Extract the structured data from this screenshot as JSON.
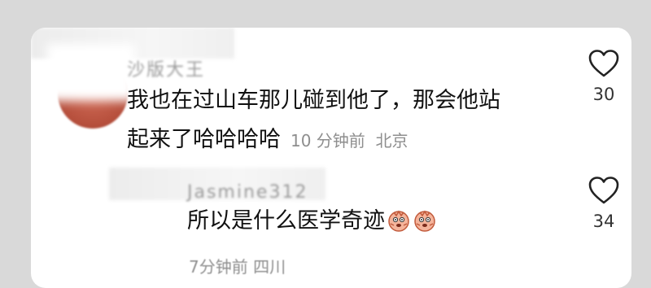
{
  "comment1": {
    "username": "沙版大王",
    "text_line1": "我也在过山车那儿碰到他了，那会他站",
    "text_line2": "起来了哈哈哈哈",
    "time": "10 分钟前",
    "location": "北京",
    "likes": "30"
  },
  "reply1": {
    "username": "Jasmine312",
    "text": "所以是什么医学奇迹",
    "emoji_icon": "scared-face-emoji",
    "time": "7分钟前",
    "location": "四川",
    "likes": "34"
  },
  "colors": {
    "text": "#111111",
    "meta": "#8e8e8e",
    "card": "#ffffff",
    "background": "#d9d9d9"
  }
}
